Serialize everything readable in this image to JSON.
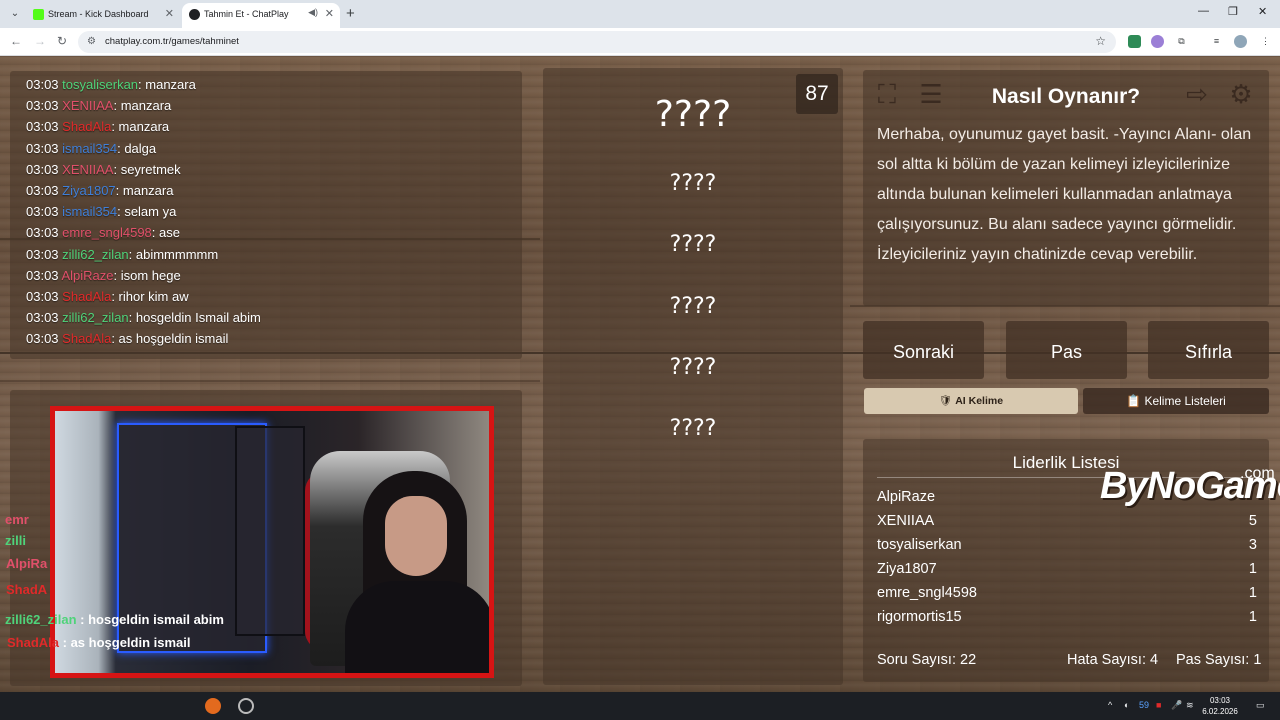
{
  "browser": {
    "tabs": [
      {
        "title": "Stream - Kick Dashboard",
        "active": false
      },
      {
        "title": "Tahmin Et - ChatPlay",
        "active": true
      }
    ],
    "url": "chatplay.com.tr/games/tahminet"
  },
  "chat": {
    "messages": [
      {
        "time": "03:03",
        "user": "tosyaliserkan",
        "text": ": manzara",
        "color": "#4fd37a"
      },
      {
        "time": "03:03",
        "user": "XENIIAA",
        "text": ": manzara",
        "color": "#e0506a"
      },
      {
        "time": "03:03",
        "user": "ShadAla",
        "text": ": manzara",
        "color": "#e02a2a"
      },
      {
        "time": "03:03",
        "user": "ismail354",
        "text": ": dalga",
        "color": "#3f7fd8"
      },
      {
        "time": "03:03",
        "user": "XENIIAA",
        "text": ": seyretmek",
        "color": "#e0506a"
      },
      {
        "time": "03:03",
        "user": "Ziya1807",
        "text": ": manzara",
        "color": "#3f7fd8"
      },
      {
        "time": "03:03",
        "user": "ismail354",
        "text": ": selam ya",
        "color": "#3f7fd8"
      },
      {
        "time": "03:03",
        "user": "emre_sngl4598",
        "text": ": ase",
        "color": "#e0506a"
      },
      {
        "time": "03:03",
        "user": "zilli62_zilan",
        "text": ": abimmmmmm",
        "color": "#4fd37a"
      },
      {
        "time": "03:03",
        "user": "AlpiRaze",
        "text": ": isom hege",
        "color": "#e0506a"
      },
      {
        "time": "03:03",
        "user": "ShadAla",
        "text": ": rihor kim aw",
        "color": "#e02a2a"
      },
      {
        "time": "03:03",
        "user": "zilli62_zilan",
        "text": ": hosgeldin Ismail abim",
        "color": "#4fd37a"
      },
      {
        "time": "03:03",
        "user": "ShadAla",
        "text": ": as hoşgeldin ismail",
        "color": "#e02a2a"
      }
    ]
  },
  "overlay_chat": [
    {
      "user": "emr",
      "color": "#e0506a"
    },
    {
      "user": "zilli",
      "color": "#4fd37a"
    },
    {
      "user": "AlpiRa",
      "color": "#e0506a"
    },
    {
      "user": "ShadA",
      "color": "#e02a2a"
    },
    {
      "user": "zilli62_zilan",
      "text": " : hosgeldin ismail abim",
      "color": "#4fd37a"
    },
    {
      "user": "ShadAla",
      "text": " : as hoşgeldin ismail",
      "color": "#e02a2a"
    }
  ],
  "game": {
    "timer": "87",
    "hidden_word": "????",
    "forbidden_words": [
      "????",
      "????",
      "????",
      "????",
      "????"
    ]
  },
  "howto": {
    "title": "Nasıl Oynanır?",
    "body": "Merhaba, oyunumuz gayet basit. -Yayıncı Alanı- olan sol altta ki bölüm de yazan kelimeyi izleyicilerinize altında bulunan kelimeleri kullanmadan anlatmaya çalışıyorsunuz. Bu alanı sadece yayıncı görmelidir. İzleyicileriniz yayın chatinizde cevap verebilir."
  },
  "controls": {
    "next": "Sonraki",
    "pass": "Pas",
    "reset": "Sıfırla",
    "ai_word": "AI Kelime",
    "word_lists": "Kelime Listeleri"
  },
  "leaderboard": {
    "title": "Liderlik Listesi",
    "rows": [
      {
        "name": "AlpiRaze",
        "score": ""
      },
      {
        "name": "XENIIAA",
        "score": "5"
      },
      {
        "name": "tosyaliserkan",
        "score": "3"
      },
      {
        "name": "Ziya1807",
        "score": "1"
      },
      {
        "name": "emre_sngl4598",
        "score": "1"
      },
      {
        "name": "rigormortis15",
        "score": "1"
      }
    ],
    "question_count_label": "Soru Sayısı: 22",
    "error_count_label": "Hata Sayısı: 4",
    "pass_count_label": "Pas Sayısı: 1",
    "logo_text": "ByNoGame",
    "logo_suffix": ".com"
  },
  "taskbar": {
    "time": "03:03",
    "date": "6.02.2026",
    "tray_number": "59"
  }
}
